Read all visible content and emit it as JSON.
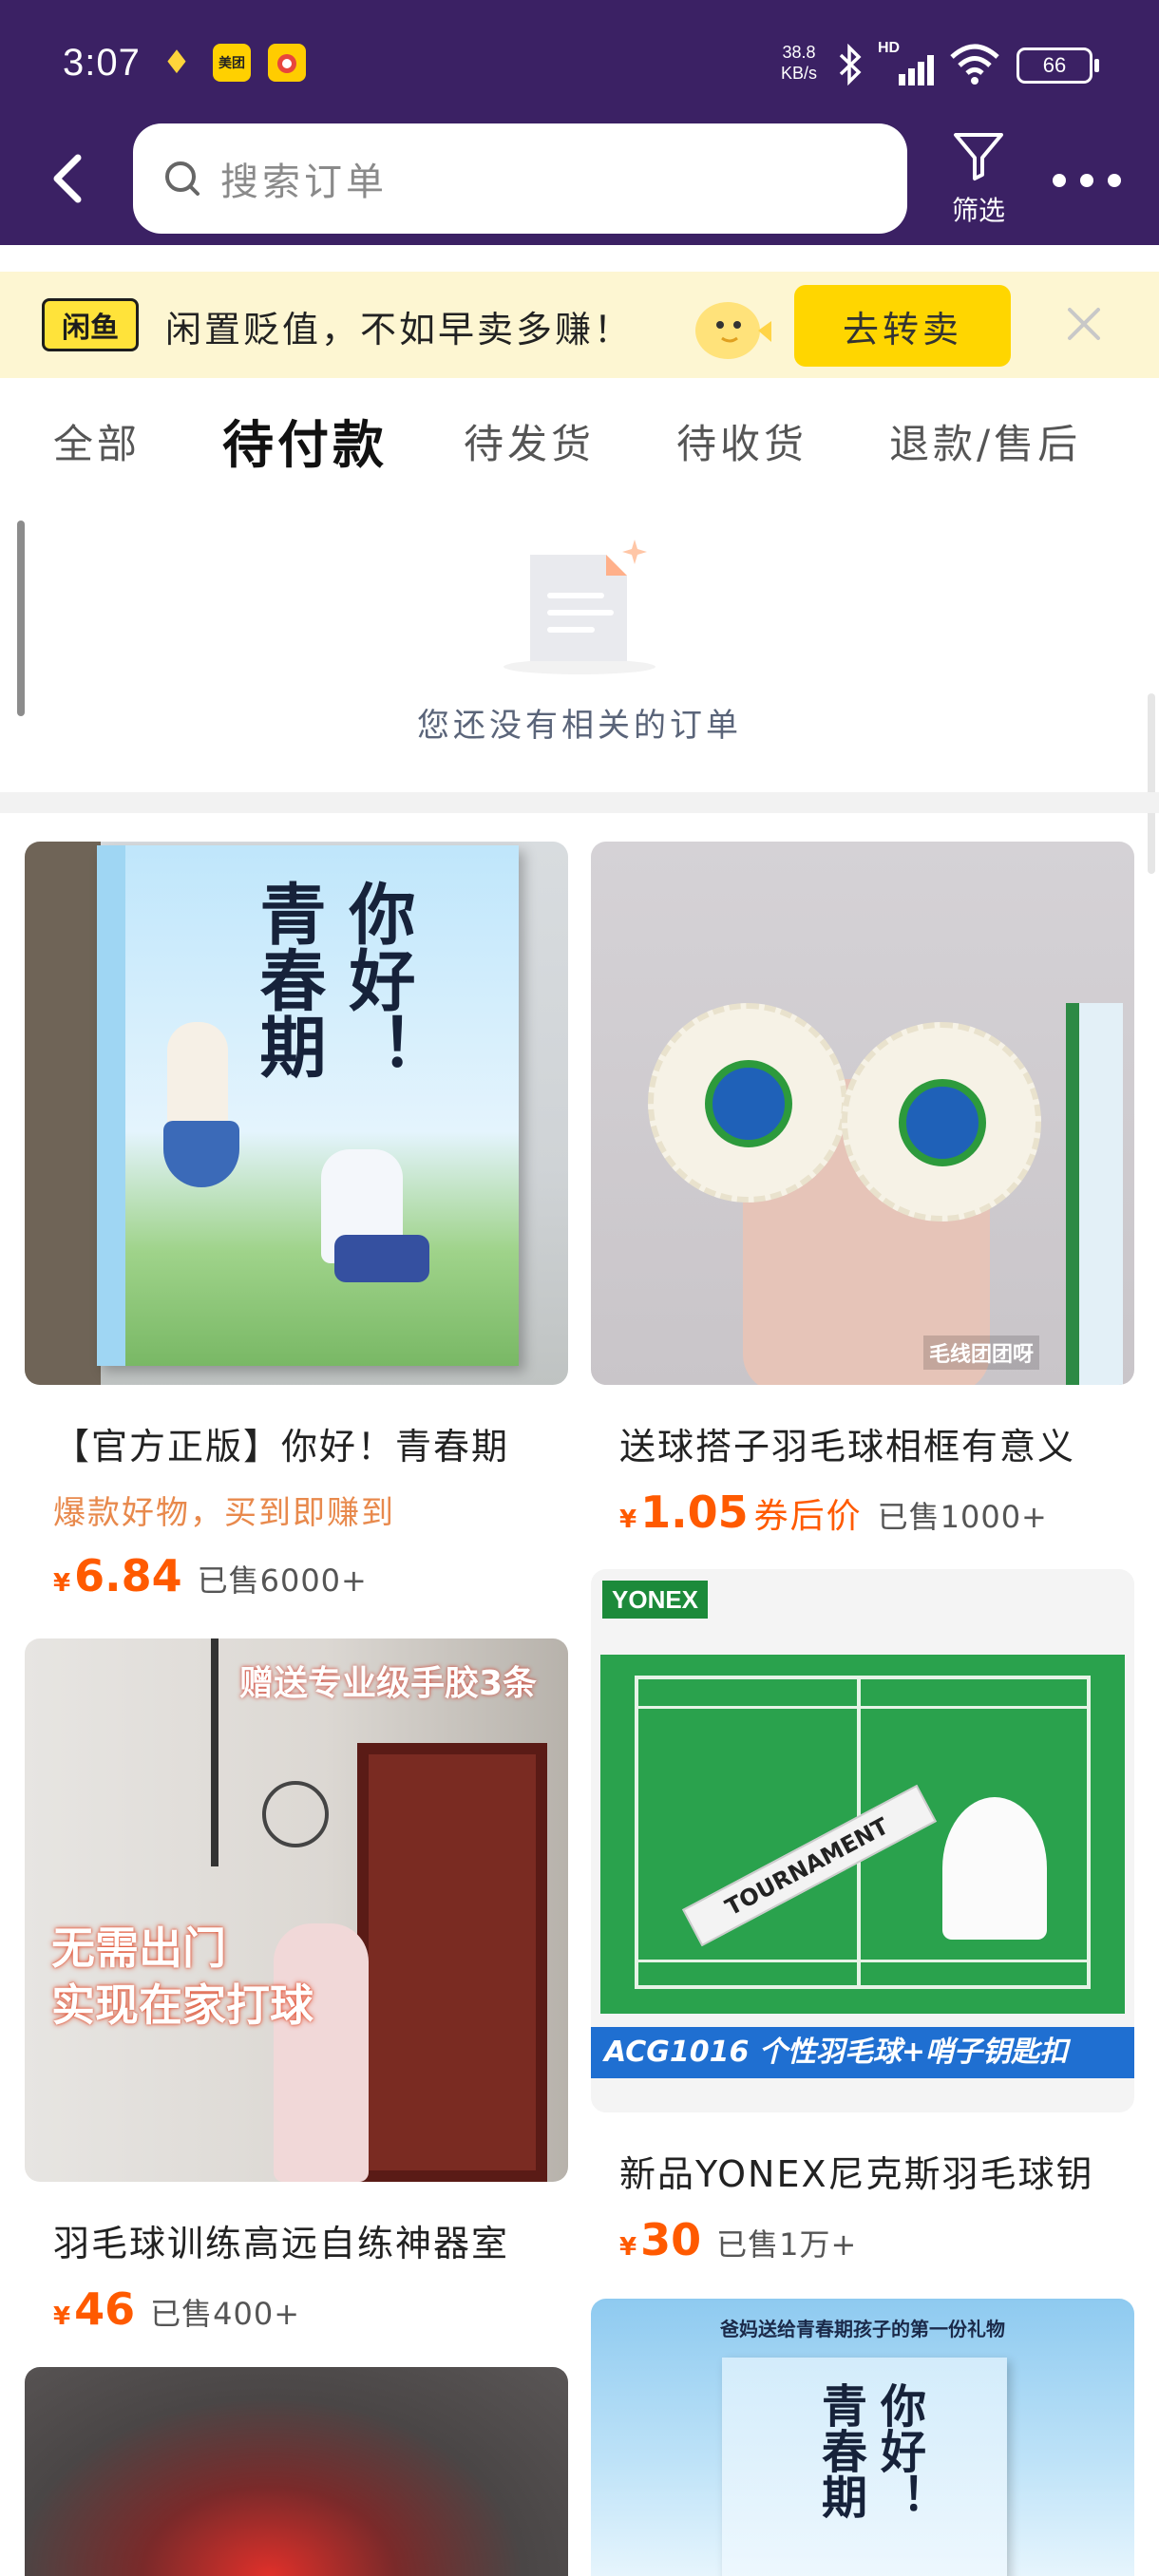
{
  "status_bar": {
    "time": "3:07",
    "net_speed": "38.8",
    "net_unit": "KB/s",
    "net_type": "HD",
    "battery": "66",
    "icons": [
      "app-notification-icon",
      "meituan-icon",
      "camera-app-icon",
      "bluetooth-icon",
      "signal-icon",
      "wifi-icon",
      "battery-icon"
    ]
  },
  "header": {
    "search_placeholder": "搜索订单",
    "filter_label": "筛选"
  },
  "banner": {
    "logo": "闲鱼",
    "text": "闲置贬值，不如早卖多赚！",
    "cta": "去转卖"
  },
  "tabs": [
    {
      "label": "全部",
      "active": false
    },
    {
      "label": "待付款",
      "active": true
    },
    {
      "label": "待发货",
      "active": false
    },
    {
      "label": "待收货",
      "active": false
    },
    {
      "label": "退款/售后",
      "active": false
    }
  ],
  "empty_state": {
    "message": "您还没有相关的订单"
  },
  "products": [
    {
      "title": "【官方正版】你好！青春期",
      "subtitle": "爆款好物，买到即赚到",
      "currency": "¥",
      "price": "6.84",
      "price_suffix": "",
      "sold": "已售6000+",
      "image_text": [
        "你好！",
        "青春期"
      ]
    },
    {
      "title": "送球搭子羽毛球相框有意义",
      "subtitle": "",
      "currency": "¥",
      "price": "1.05",
      "price_suffix": "券后价",
      "sold": "已售1000+",
      "image_text": [
        "毛线团团呀"
      ]
    },
    {
      "title": "新品YONEX尼克斯羽毛球钥",
      "subtitle": "",
      "currency": "¥",
      "price": "30",
      "price_suffix": "",
      "sold": "已售1万+",
      "image_text": [
        "YONEX",
        "ACG1016 个性羽毛球+哨子钥匙扣",
        "TOURNAMENT"
      ]
    },
    {
      "title": "羽毛球训练高远自练神器室",
      "subtitle": "",
      "currency": "¥",
      "price": "46",
      "price_suffix": "",
      "sold": "已售400+",
      "image_text": [
        "赠送专业级手胶3条",
        "无需出门",
        "实现在家打球"
      ]
    },
    {
      "title": "",
      "subtitle": "",
      "image_text": [
        "爸妈送给青春期孩子的第一份礼物",
        "你好！",
        "青春期"
      ]
    }
  ],
  "colors": {
    "header_bg": "#3b2164",
    "banner_bg": "#fdf6d2",
    "cta_bg": "#ffd600",
    "price": "#ff5a00",
    "subtitle": "#e8894c"
  }
}
